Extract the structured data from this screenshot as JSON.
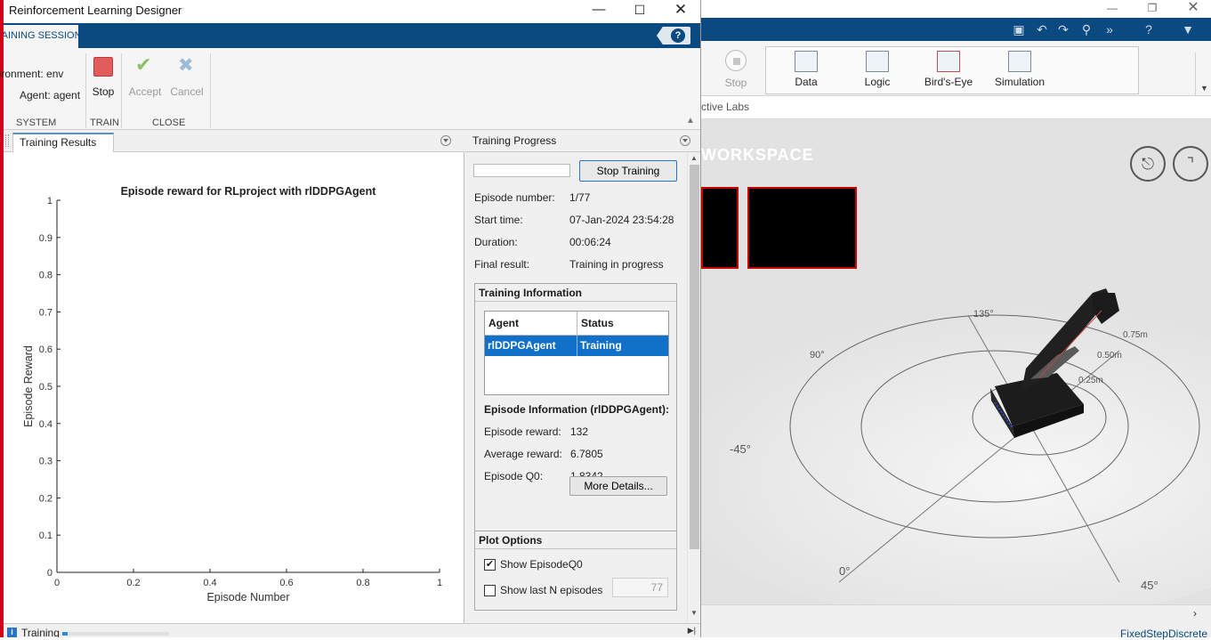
{
  "background_app": {
    "ribbon": {
      "stop_label": "Stop",
      "gallery": [
        {
          "label": "Data",
          "icon": "data-inspector-icon"
        },
        {
          "label": "Logic",
          "icon": "logic-analyzer-icon"
        },
        {
          "label": "Bird's-Eye",
          "icon": "birds-eye-scope-icon"
        },
        {
          "label": "Simulation",
          "icon": "simulation-manager-icon"
        }
      ]
    },
    "breadcrumb": "ctive Labs",
    "workspace_label": "WORKSPACE",
    "scene_labels": {
      "deg_135": "135°",
      "deg_90": "90°",
      "deg_neg45": "-45°",
      "deg_0": "0°",
      "deg_45": "45°",
      "r_075": "0.75m",
      "r_050": "0.50m",
      "r_025": "0.25m"
    },
    "status_text": "FixedStepDiscrete"
  },
  "window": {
    "title": "Reinforcement Learning Designer",
    "tab": "TRAINING SESSION"
  },
  "toolstrip": {
    "environment_label": "Environment: env",
    "agent_label": "Agent: agent",
    "stop": "Stop",
    "accept": "Accept",
    "cancel": "Cancel",
    "group_system": "SYSTEM",
    "group_train": "TRAIN",
    "group_close": "CLOSE"
  },
  "results": {
    "tab_label": "Training Results"
  },
  "chart_data": {
    "type": "line",
    "title": "Episode reward for RLproject with rlDDPGAgent",
    "xlabel": "Episode Number",
    "ylabel": "Episode Reward",
    "xlim": [
      0,
      1
    ],
    "ylim": [
      0,
      1
    ],
    "xticks": [
      "0",
      "0.2",
      "0.4",
      "0.6",
      "0.8",
      "1"
    ],
    "yticks": [
      "0",
      "0.1",
      "0.2",
      "0.3",
      "0.4",
      "0.5",
      "0.6",
      "0.7",
      "0.8",
      "0.9",
      "1"
    ],
    "series": [],
    "grid": false
  },
  "progress": {
    "header": "Training Progress",
    "progress_fraction": 0.0,
    "stop_training_label": "Stop Training",
    "episode_number_label": "Episode number:",
    "episode_number_value": "1/77",
    "start_time_label": "Start time:",
    "start_time_value": "07-Jan-2024 23:54:28",
    "duration_label": "Duration:",
    "duration_value": "00:06:24",
    "final_result_label": "Final result:",
    "final_result_value": "Training in progress",
    "training_info": {
      "title": "Training Information",
      "columns": [
        "Agent",
        "Status"
      ],
      "rows": [
        {
          "agent": "rlDDPGAgent",
          "status": "Training"
        }
      ],
      "episode_info_title": "Episode Information (rlDDPGAgent):",
      "episode_reward_label": "Episode reward:",
      "episode_reward_value": "132",
      "average_reward_label": "Average reward:",
      "average_reward_value": "6.7805",
      "episode_q0_label": "Episode Q0:",
      "episode_q0_value": "1.8342",
      "more_details_label": "More Details..."
    },
    "plot_options": {
      "title": "Plot Options",
      "show_q0_label": "Show EpisodeQ0",
      "show_q0_checked": true,
      "show_last_n_label": "Show last N episodes",
      "show_last_n_checked": false,
      "n_value": "77"
    }
  },
  "status": {
    "text": "Training",
    "progress_fraction": 0.05
  },
  "colors": {
    "titlebar_blue": "#0a4a80",
    "selected_row": "#1170c8",
    "progress_green": "#06b025",
    "stop_red": "#e25c5c"
  }
}
